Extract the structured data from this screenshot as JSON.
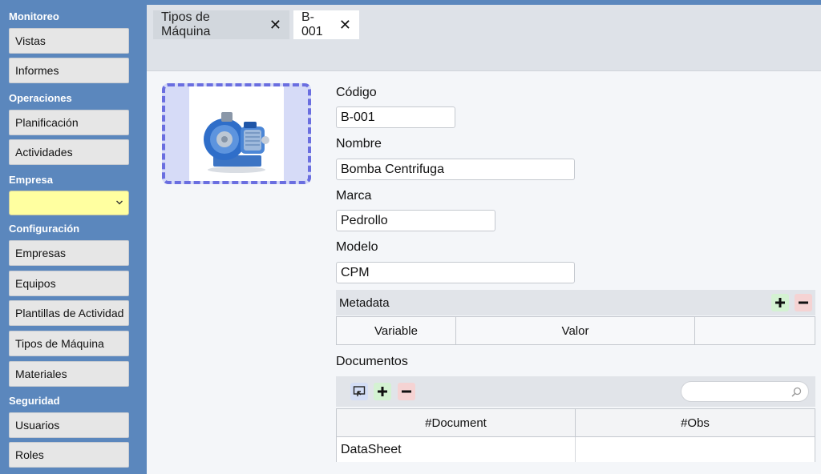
{
  "sidebar": {
    "sections": [
      {
        "title": "Monitoreo",
        "items": [
          "Vistas",
          "Informes"
        ]
      },
      {
        "title": "Operaciones",
        "items": [
          "Planificación",
          "Actividades"
        ]
      },
      {
        "title": "Empresa",
        "select_value": ""
      },
      {
        "title": "Configuración",
        "items": [
          "Empresas",
          "Equipos",
          "Plantillas de Actividad",
          "Tipos de Máquina",
          "Materiales"
        ]
      },
      {
        "title": "Seguridad",
        "items": [
          "Usuarios",
          "Roles"
        ]
      }
    ],
    "select_color": "#ffffa0"
  },
  "tabs": [
    {
      "label": "Tipos de Máquina",
      "close": "✕"
    },
    {
      "label": "B-001",
      "close": "✕",
      "active": true
    }
  ],
  "form": {
    "codigo_label": "Código",
    "codigo_value": "B-001",
    "nombre_label": "Nombre",
    "nombre_value": "Bomba Centrifuga",
    "marca_label": "Marca",
    "marca_value": "Pedrollo",
    "modelo_label": "Modelo",
    "modelo_value": "CPM"
  },
  "metadata": {
    "title": "Metadata",
    "columns": [
      "Variable",
      "Valor",
      ""
    ]
  },
  "documentos": {
    "title": "Documentos",
    "search_placeholder": "",
    "columns": [
      "#Document",
      "#Obs"
    ],
    "rows": [
      [
        "DataSheet",
        ""
      ]
    ]
  },
  "image": {
    "icon": "centrifugal-pump-image"
  },
  "colors": {
    "sidebar": "#5b87bd",
    "accent_dashed": "#6a6ee0",
    "plus": "#118811",
    "minus": "#cc1111"
  }
}
